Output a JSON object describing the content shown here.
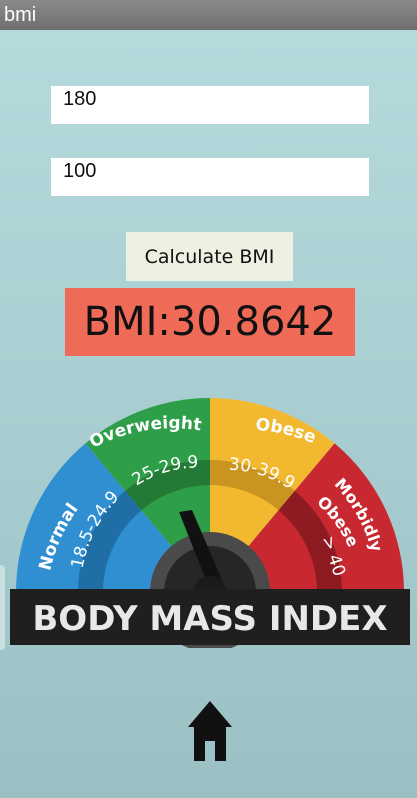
{
  "app": {
    "title": "bmi"
  },
  "inputs": {
    "height_value": "180",
    "weight_value": "100"
  },
  "buttons": {
    "calculate_label": "Calculate BMI"
  },
  "result": {
    "text": "BMI:30.8642"
  },
  "gauge": {
    "categories": [
      {
        "name": "Normal",
        "range": "18.5-24.9",
        "color": "#2f8fd1"
      },
      {
        "name": "Overweight",
        "range": "25-29.9",
        "color": "#2e9e48"
      },
      {
        "name": "Obese",
        "range": "30-39.9",
        "color": "#f2b930"
      },
      {
        "name_line1": "Morbidly",
        "name_line2": "Obese",
        "range": "> 40",
        "color": "#c8282f"
      }
    ],
    "caption": "BODY MASS INDEX"
  },
  "icons": {
    "home": "home-icon"
  },
  "colors": {
    "result_bg": "#f06b57",
    "button_bg": "#eef1e2",
    "titlebar_bg": "#7a7a7a"
  }
}
